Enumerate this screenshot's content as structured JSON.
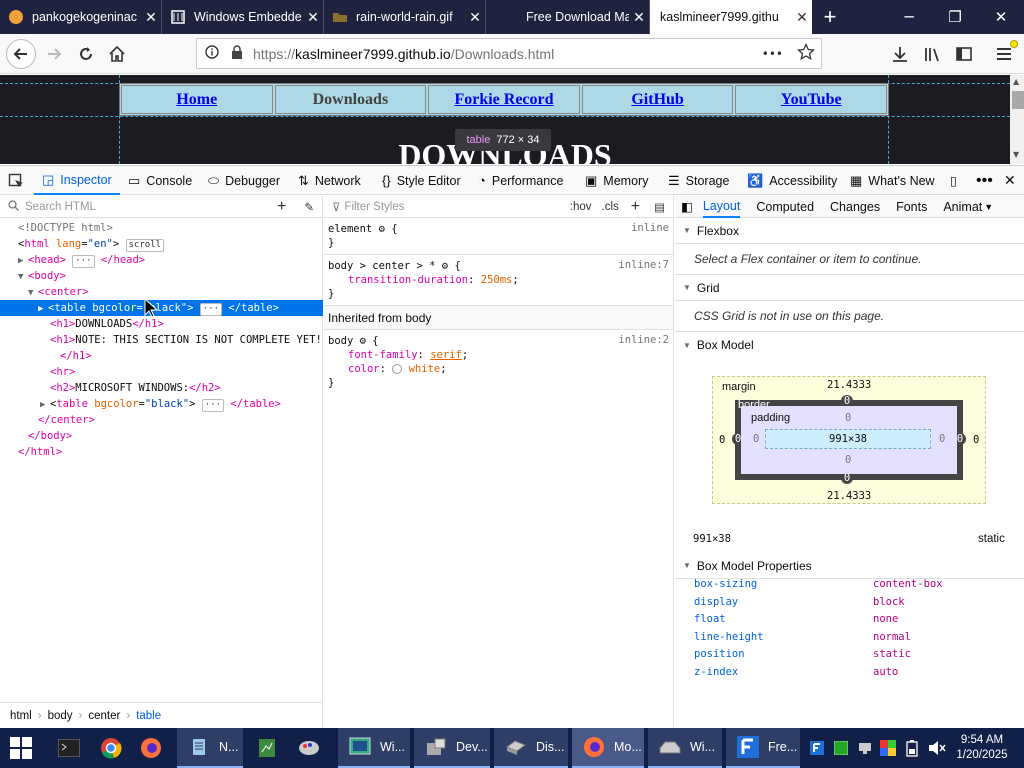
{
  "browser": {
    "tabs": [
      {
        "title": "pankogekogeninac",
        "icon": "orange-circle-icon"
      },
      {
        "title": "Windows Embedde",
        "icon": "wikipedia-icon"
      },
      {
        "title": "rain-world-rain.gif",
        "icon": "image-file-icon"
      },
      {
        "title": "Free Download Ma",
        "icon": ""
      },
      {
        "title": "kaslmineer7999.githu",
        "icon": ""
      }
    ],
    "new_tab_label": "+",
    "url_prefix": "https://",
    "url_host": "kaslmineer7999.github.io",
    "url_path": "/Downloads.html",
    "more_label": "•••"
  },
  "page": {
    "nav_links": [
      "Home",
      "Downloads",
      "Forkie Record",
      "GitHub",
      "YouTube"
    ],
    "heading": "DOWNLOADS"
  },
  "tooltip": {
    "tag": "table",
    "size": "772 × 34"
  },
  "devtools": {
    "tabs": [
      "Inspector",
      "Console",
      "Debugger",
      "Network",
      "Style Editor",
      "Performance",
      "Memory",
      "Storage",
      "Accessibility",
      "What's New"
    ],
    "search_html_placeholder": "Search HTML",
    "filter_styles_placeholder": "Filter Styles",
    "hov_label": ":hov",
    "cls_label": ".cls",
    "tree": {
      "doctype": "<!DOCTYPE html>",
      "html_open_tag": "html",
      "html_lang_attr": "lang",
      "html_lang_val": "\"en\"",
      "scroll_badge": "scroll",
      "head_open": "<head>",
      "head_close": "</head>",
      "body_open": "<body>",
      "center_open": "<center>",
      "table1_tag": "table",
      "table_attr": "bgcolor",
      "table_val": "\"black\"",
      "table_close": "</table>",
      "h1_downloads": "DOWNLOADS",
      "h1_note": "NOTE: THIS SECTION IS NOT COMPLETE YET!",
      "h1_close": "</h1>",
      "hr": "<hr>",
      "h2_text": "MICROSOFT WINDOWS:",
      "h2_close": "</h2>",
      "center_close": "</center>",
      "body_close": "</body>",
      "html_close": "</html>"
    },
    "breadcrumbs": [
      "html",
      "body",
      "center",
      "table"
    ],
    "rules": {
      "element_selector": "element",
      "element_source": "inline",
      "rule2_selector": "body > center > *",
      "rule2_source": "inline:7",
      "rule2_prop": "transition-duration",
      "rule2_val": "250ms",
      "inherited_label": "Inherited from body",
      "rule3_selector": "body",
      "rule3_source": "inline:2",
      "rule3_prop1": "font-family",
      "rule3_val1": "serif",
      "rule3_prop2": "color",
      "rule3_val2": "white"
    },
    "layout_tabs": [
      "Layout",
      "Computed",
      "Changes",
      "Fonts",
      "Animat"
    ],
    "flexbox_title": "Flexbox",
    "flexbox_note": "Select a Flex container or item to continue.",
    "grid_title": "Grid",
    "grid_note": "CSS Grid is not in use on this page.",
    "box_model_title": "Box Model",
    "box_model": {
      "margin_label": "margin",
      "margin_top": "21.4333",
      "margin_bottom": "21.4333",
      "margin_left": "0",
      "margin_right": "0",
      "border_label": "border",
      "border_top": "0",
      "border_bottom": "0",
      "border_left": "0",
      "border_right": "0",
      "padding_label": "padding",
      "padding_top": "0",
      "padding_bottom": "0",
      "padding_left": "0",
      "padding_right": "0",
      "content": "991×38",
      "dims": "991×38",
      "position": "static"
    },
    "box_model_props_title": "Box Model Properties",
    "box_model_props": [
      {
        "name": "box-sizing",
        "value": "content-box"
      },
      {
        "name": "display",
        "value": "block"
      },
      {
        "name": "float",
        "value": "none"
      },
      {
        "name": "line-height",
        "value": "normal"
      },
      {
        "name": "position",
        "value": "static"
      },
      {
        "name": "z-index",
        "value": "auto"
      }
    ]
  },
  "taskbar": {
    "items": [
      {
        "label": "N...",
        "icon": "notepad-icon"
      },
      {
        "label": "Wi...",
        "icon": "windows-app-icon"
      },
      {
        "label": "Dev...",
        "icon": "device-manager-icon"
      },
      {
        "label": "Dis...",
        "icon": "disk-icon"
      },
      {
        "label": "Mo...",
        "icon": "firefox-icon"
      },
      {
        "label": "Wi...",
        "icon": "drive-icon"
      },
      {
        "label": "Fre...",
        "icon": "download-manager-icon"
      }
    ],
    "time": "9:54 AM",
    "date": "1/20/2025"
  }
}
